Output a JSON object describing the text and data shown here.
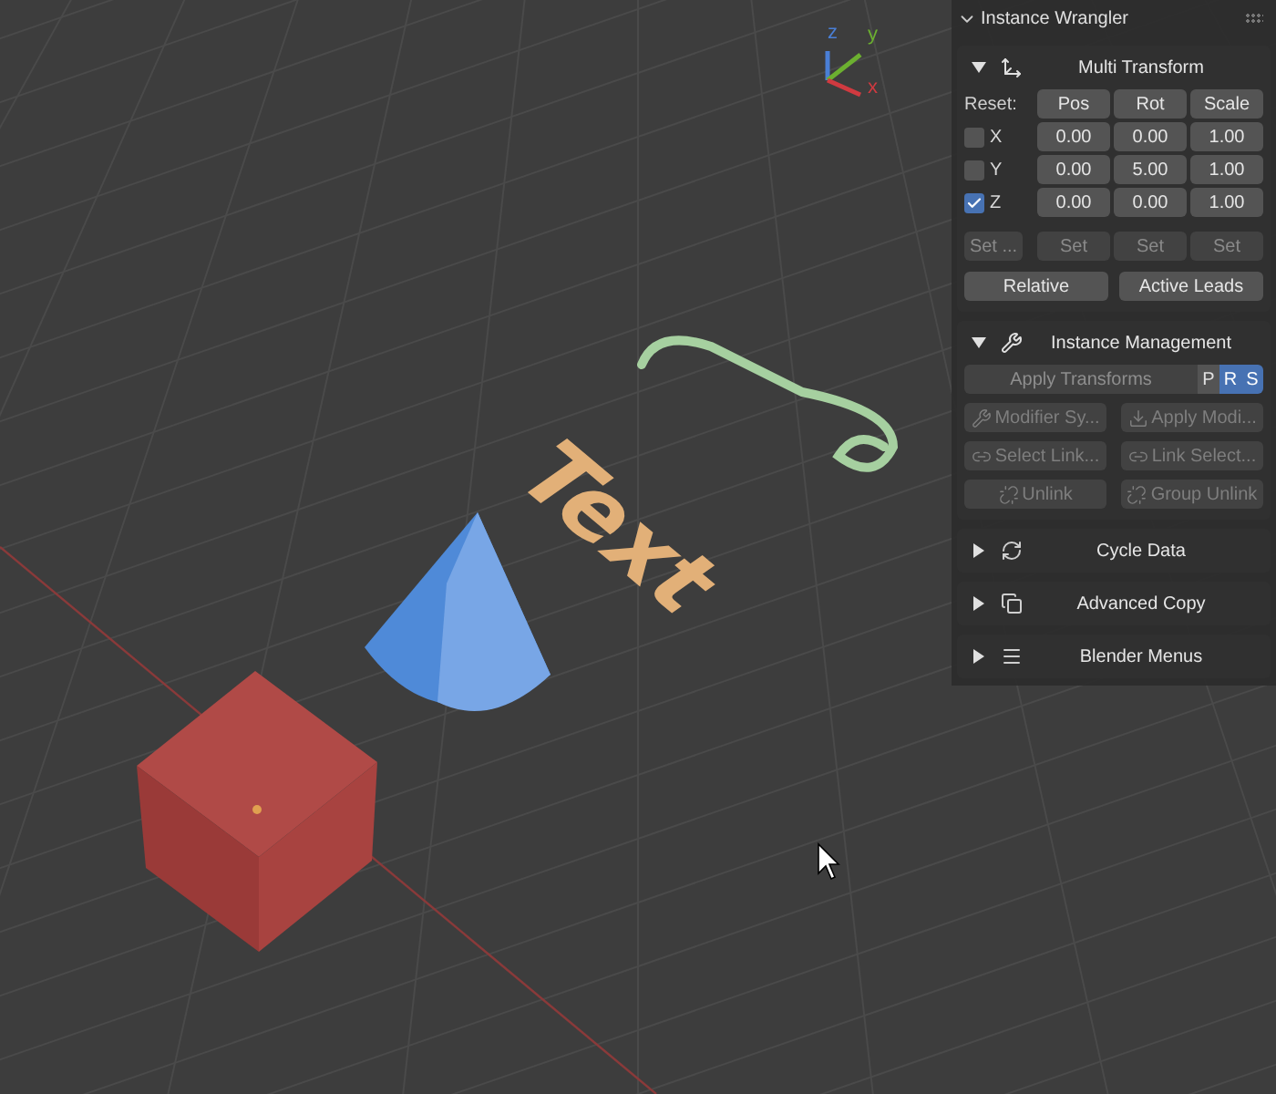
{
  "viewport": {
    "text_object": "Text",
    "gizmo": [
      {
        "label": "z"
      },
      {
        "label": "y"
      },
      {
        "label": "x"
      }
    ]
  },
  "panel": {
    "title": "Instance Wrangler",
    "expanded": true,
    "sections": [
      {
        "kind": "transform",
        "title": "Multi Transform",
        "expanded": true,
        "reset_label": "Reset:",
        "columns": [
          "Pos",
          "Rot",
          "Scale"
        ],
        "rows": [
          {
            "axis": "X",
            "checked": false,
            "values": [
              "0.00",
              "0.00",
              "1.00"
            ]
          },
          {
            "axis": "Y",
            "checked": false,
            "values": [
              "0.00",
              "5.00",
              "1.00"
            ]
          },
          {
            "axis": "Z",
            "checked": true,
            "values": [
              "0.00",
              "0.00",
              "1.00"
            ]
          }
        ],
        "set_buttons": [
          "Set ...",
          "Set",
          "Set",
          "Set"
        ],
        "toggles": [
          {
            "label": "Relative",
            "selected": false
          },
          {
            "label": "Active Leads",
            "selected": false
          }
        ]
      },
      {
        "kind": "management",
        "title": "Instance Management",
        "expanded": true,
        "apply": {
          "label": "Apply Transforms",
          "flags": [
            {
              "label": "P",
              "selected": false
            },
            {
              "label": "R",
              "selected": true
            },
            {
              "label": "S",
              "selected": true
            }
          ]
        },
        "buttons": [
          {
            "label": "Modifier Sy...",
            "disabled": true
          },
          {
            "label": "Apply Modi...",
            "disabled": true
          },
          {
            "label": "Select Link...",
            "disabled": true
          },
          {
            "label": "Link Select...",
            "disabled": true
          },
          {
            "label": "Unlink",
            "disabled": true
          },
          {
            "label": "Group Unlink",
            "disabled": true
          }
        ]
      },
      {
        "kind": "collapsed",
        "title": "Cycle Data",
        "expanded": false
      },
      {
        "kind": "collapsed",
        "title": "Advanced Copy",
        "expanded": false
      },
      {
        "kind": "collapsed",
        "title": "Blender Menus",
        "expanded": false
      }
    ]
  }
}
